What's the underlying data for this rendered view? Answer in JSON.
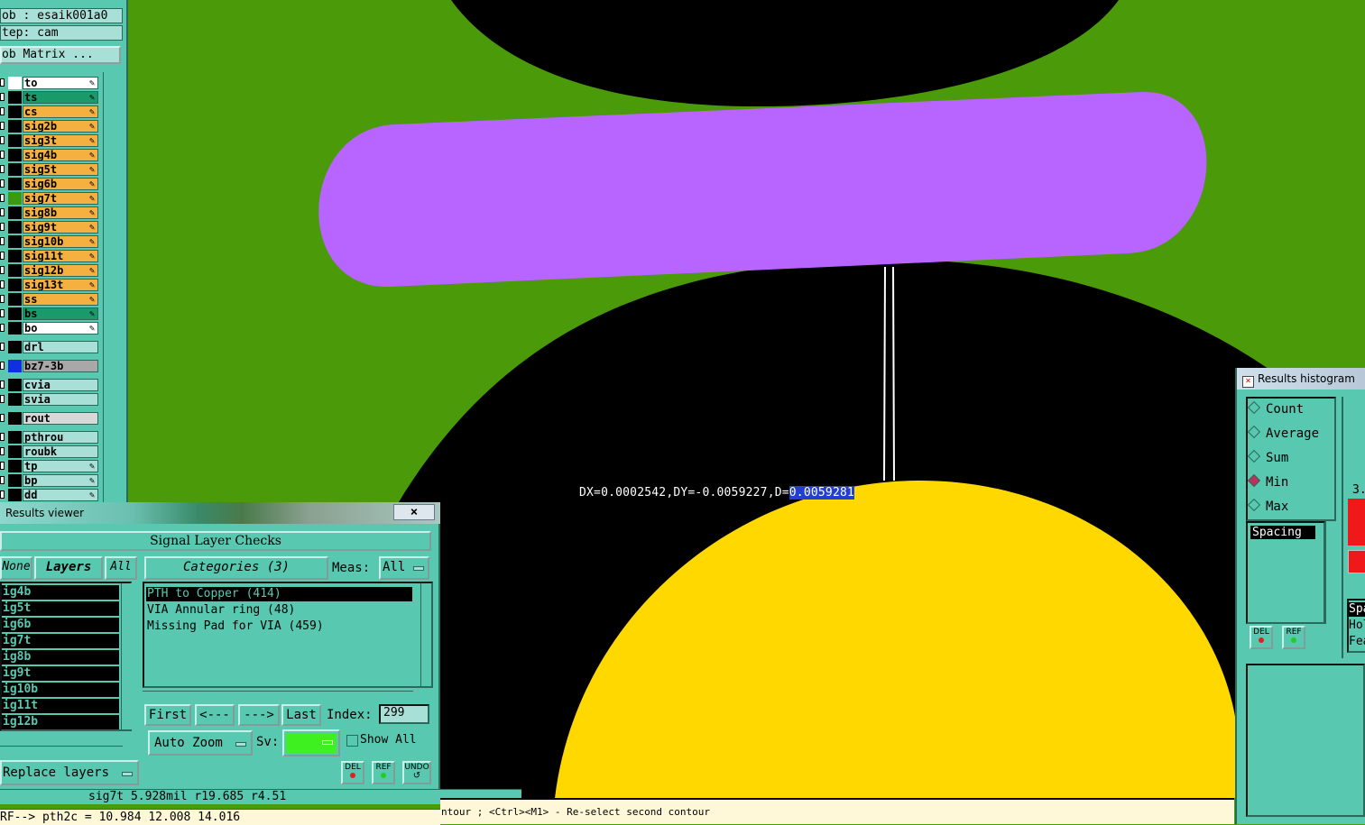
{
  "header": {
    "job": "ob : esaik001a0",
    "step": "tep: cam",
    "job_matrix": "ob Matrix ..."
  },
  "layers": [
    {
      "name": "to",
      "color": "#ffffff",
      "bg": "#ffffff",
      "edit": true
    },
    {
      "name": "ts",
      "color": "#000000",
      "bg": "#1a9a6a",
      "edit": true
    },
    {
      "name": "cs",
      "color": "#000000",
      "bg": "#f4b040",
      "edit": true
    },
    {
      "name": "sig2b",
      "color": "#000000",
      "bg": "#f4b040",
      "edit": true
    },
    {
      "name": "sig3t",
      "color": "#000000",
      "bg": "#f4b040",
      "edit": true
    },
    {
      "name": "sig4b",
      "color": "#000000",
      "bg": "#f4b040",
      "edit": true
    },
    {
      "name": "sig5t",
      "color": "#000000",
      "bg": "#f4b040",
      "edit": true
    },
    {
      "name": "sig6b",
      "color": "#000000",
      "bg": "#f4b040",
      "edit": true
    },
    {
      "name": "sig7t",
      "color": "#3a9a10",
      "bg": "#f4b040",
      "edit": true
    },
    {
      "name": "sig8b",
      "color": "#000000",
      "bg": "#f4b040",
      "edit": true
    },
    {
      "name": "sig9t",
      "color": "#000000",
      "bg": "#f4b040",
      "edit": true
    },
    {
      "name": "sig10b",
      "color": "#000000",
      "bg": "#f4b040",
      "edit": true
    },
    {
      "name": "sig11t",
      "color": "#000000",
      "bg": "#f4b040",
      "edit": true
    },
    {
      "name": "sig12b",
      "color": "#000000",
      "bg": "#f4b040",
      "edit": true
    },
    {
      "name": "sig13t",
      "color": "#000000",
      "bg": "#f4b040",
      "edit": true
    },
    {
      "name": "ss",
      "color": "#000000",
      "bg": "#f4b040",
      "edit": true
    },
    {
      "name": "bs",
      "color": "#000000",
      "bg": "#1a9a6a",
      "edit": true
    },
    {
      "name": "bo",
      "color": "#000000",
      "bg": "#ffffff",
      "edit": true
    },
    {
      "name": "drl",
      "color": "#000000",
      "bg": "#a8e0d8",
      "edit": false
    },
    {
      "name": "bz7-3b",
      "color": "#1030e0",
      "bg": "#a8a8a8",
      "edit": false
    },
    {
      "name": "cvia",
      "color": "#000000",
      "bg": "#a8e0d8",
      "edit": false
    },
    {
      "name": "svia",
      "color": "#000000",
      "bg": "#a8e0d8",
      "edit": false
    },
    {
      "name": "rout",
      "color": "#000000",
      "bg": "#d8d8d8",
      "edit": false
    },
    {
      "name": "pthrou",
      "color": "#000000",
      "bg": "#a8e0d8",
      "edit": false
    },
    {
      "name": "roubk",
      "color": "#000000",
      "bg": "#a8e0d8",
      "edit": false
    },
    {
      "name": "tp",
      "color": "#000000",
      "bg": "#a8e0d8",
      "edit": true
    },
    {
      "name": "bp",
      "color": "#000000",
      "bg": "#a8e0d8",
      "edit": true
    },
    {
      "name": "dd",
      "color": "#000000",
      "bg": "#a8e0d8",
      "edit": true
    }
  ],
  "canvas": {
    "measure_prefix": "DX=0.0002542,DY=-0.0059227,D=",
    "measure_value": "0.0059281",
    "colors": {
      "background": "#4a9a0a",
      "pad": "#b865ff",
      "dark": "#000000",
      "copper": "#ffd800"
    }
  },
  "results_viewer": {
    "title": "Results viewer",
    "close": "×",
    "heading": "Signal Layer Checks",
    "none_btn": "None",
    "layers_btn": "Layers",
    "all_btn": "All",
    "categories_btn": "Categories (3)",
    "meas_label": "Meas:",
    "meas_value": "All",
    "layer_items": [
      "ig4b",
      "ig5t",
      "ig6b",
      "ig7t",
      "ig8b",
      "ig9t",
      "ig10b",
      "ig11t",
      "ig12b"
    ],
    "categories": [
      {
        "label": "PTH to Copper (414)",
        "selected": true
      },
      {
        "label": "VIA Annular ring (48)",
        "selected": false
      },
      {
        "label": "Missing Pad for VIA (459)",
        "selected": false
      }
    ],
    "first": "First",
    "prev": "<---",
    "next": "--->",
    "last": "Last",
    "index_label": "Index:",
    "index_value": "299",
    "auto_zoom": "Auto Zoom",
    "sv_label": "Sv:",
    "show_all": "Show All",
    "replace_layers": "Replace layers",
    "del": "DEL",
    "ref": "REF",
    "undo": "UNDO",
    "status": "sig7t 5.928mil  r19.685  r4.51",
    "ref_line": "RF--> pth2c = 10.984 12.008 14.016"
  },
  "prompt": "ntour ; <Ctrl><M1> - Re-select second contour",
  "histogram": {
    "title": "Results histogram",
    "options": [
      {
        "label": "Count",
        "on": false
      },
      {
        "label": "Average",
        "on": false
      },
      {
        "label": "Sum",
        "on": false
      },
      {
        "label": "Min",
        "on": true
      },
      {
        "label": "Max",
        "on": false
      }
    ],
    "list_item": "Spacing",
    "del": "DEL",
    "ref": "REF",
    "value_label": "3.",
    "right_items": [
      "Spa",
      "Hol",
      "Fea"
    ]
  }
}
